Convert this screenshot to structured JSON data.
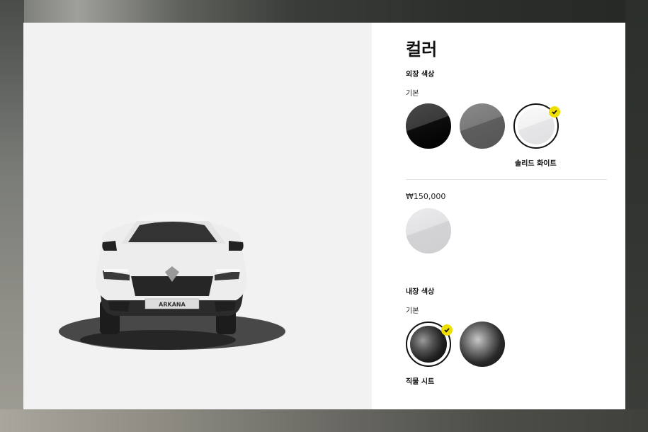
{
  "color_panel": {
    "title": "컬러",
    "exterior": {
      "heading": "외장 색상",
      "basic_label": "기본",
      "swatches": [
        {
          "name": "black-swatch",
          "color": "#111111",
          "selected": false
        },
        {
          "name": "gray-swatch",
          "color": "#6a6a6a",
          "selected": false
        },
        {
          "name": "white-swatch",
          "color": "#f0f0f2",
          "selected": true
        }
      ],
      "selected_name": "솔리드 화이트",
      "option_price": "₩150,000",
      "option_swatch": {
        "name": "light-gray-swatch",
        "color": "#d9d9db"
      }
    },
    "interior": {
      "heading": "내장 색상",
      "basic_label": "기본",
      "swatches": [
        {
          "name": "fabric-seat-swatch",
          "selected": true
        },
        {
          "name": "alt-seat-swatch",
          "selected": false
        }
      ],
      "selected_name": "직물 시트"
    }
  },
  "car": {
    "plate_text": "ARKANA",
    "body_color": "#ededed"
  }
}
